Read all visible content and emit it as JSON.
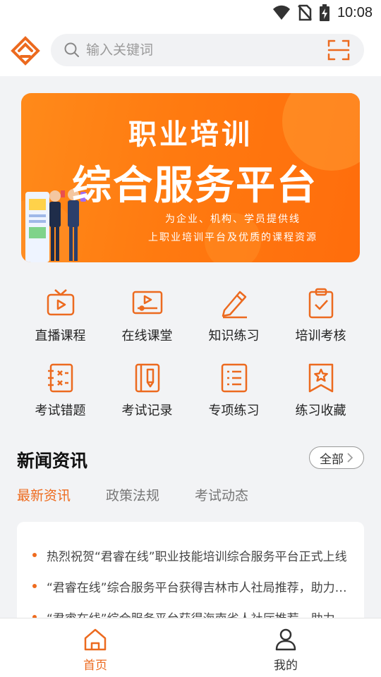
{
  "status_bar": {
    "time": "10:08",
    "icons": [
      "wifi-icon",
      "no-sim-icon",
      "battery-charging-icon"
    ]
  },
  "header": {
    "logo": "app-logo",
    "search": {
      "placeholder": "输入关键词",
      "value": ""
    },
    "scan_icon": "scan-icon"
  },
  "banner": {
    "title_line1": "职业培训",
    "title_line2": "综合服务平台",
    "subtitle_line1": "为企业、机构、学员提供线",
    "subtitle_line2": "上职业培训平台及优质的课程资源"
  },
  "grid": [
    {
      "label": "直播课程",
      "icon": "live-tv-icon"
    },
    {
      "label": "在线课堂",
      "icon": "video-player-icon"
    },
    {
      "label": "知识练习",
      "icon": "pencil-icon"
    },
    {
      "label": "培训考核",
      "icon": "clipboard-check-icon"
    },
    {
      "label": "考试错题",
      "icon": "wrong-notebook-icon"
    },
    {
      "label": "考试记录",
      "icon": "record-book-icon"
    },
    {
      "label": "专项练习",
      "icon": "list-document-icon"
    },
    {
      "label": "练习收藏",
      "icon": "star-bookmark-icon"
    }
  ],
  "news": {
    "title": "新闻资讯",
    "all_label": "全部",
    "tabs": [
      "最新资讯",
      "政策法规",
      "考试动态"
    ],
    "active_tab": 0,
    "items": [
      "热烈祝贺“君睿在线”职业技能培训综合服务平台正式上线",
      "“君睿在线”综合服务平台获得吉林市人社局推荐，助力职业技能培训",
      "“君睿在线”综合服务平台获得海南省人社厅推荐，助力职业技能培训"
    ]
  },
  "bottom_nav": [
    {
      "label": "首页",
      "icon": "home-icon",
      "active": true
    },
    {
      "label": "我的",
      "icon": "user-icon",
      "active": false
    }
  ],
  "colors": {
    "accent": "#ee6b1e",
    "banner": "#ff7d12",
    "background": "#f2f3f5"
  }
}
